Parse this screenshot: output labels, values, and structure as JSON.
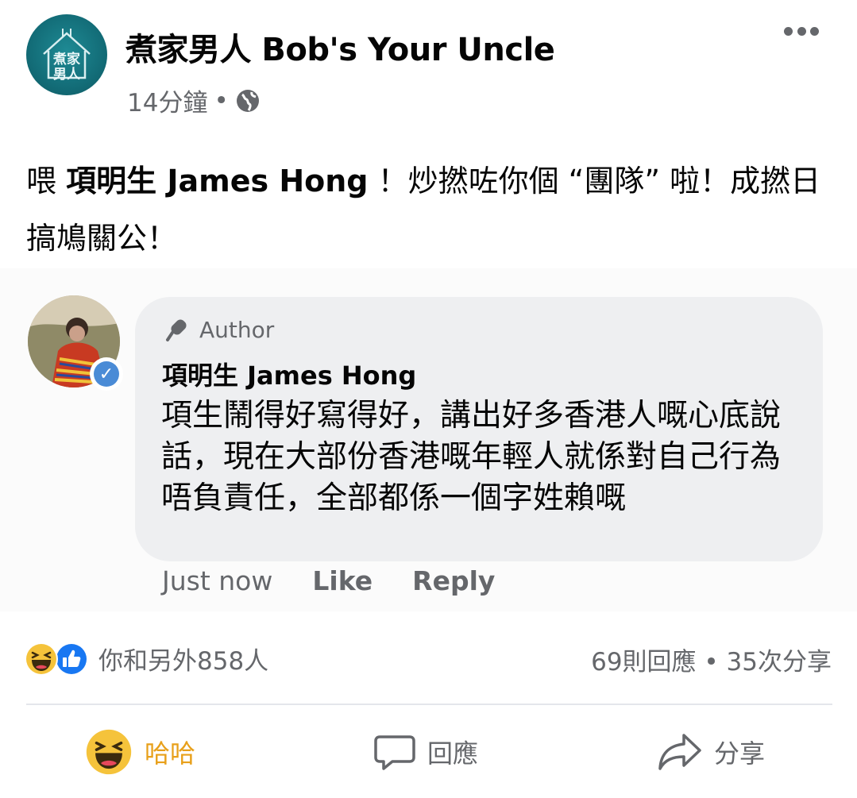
{
  "post": {
    "page_name": "煮家男人 Bob's Your Uncle",
    "avatar_text": "煮家男人",
    "time": "14分鐘",
    "meta_separator": "•",
    "audience_icon": "globe-icon",
    "text_prefix": "喂 ",
    "text_mention": "項明生 James Hong",
    "text_suffix": " ！炒撚咗你個 “團隊” 啦！成撚日搞鳩關公！"
  },
  "embedded_comment": {
    "author_badge": "Author",
    "name": "項明生 James Hong",
    "text": "項生鬧得好寫得好，講出好多香港人嘅心底說話，現在大部份香港嘅年輕人就係對自己行為唔負責任，全部都係一個字姓賴嘅",
    "time": "Just now",
    "like_label": "Like",
    "reply_label": "Reply"
  },
  "summary": {
    "reactions_text": "你和另外858人",
    "stats_text": "69則回應 • 35次分享"
  },
  "actions": {
    "reaction_label": "哈哈",
    "comment_label": "回應",
    "share_label": "分享"
  },
  "colors": {
    "haha": "#e8a01a",
    "like_blue": "#1877f2",
    "secondary_text": "#65676b",
    "avatar_teal": "#136d78",
    "bubble_bg": "#eeeff1"
  }
}
